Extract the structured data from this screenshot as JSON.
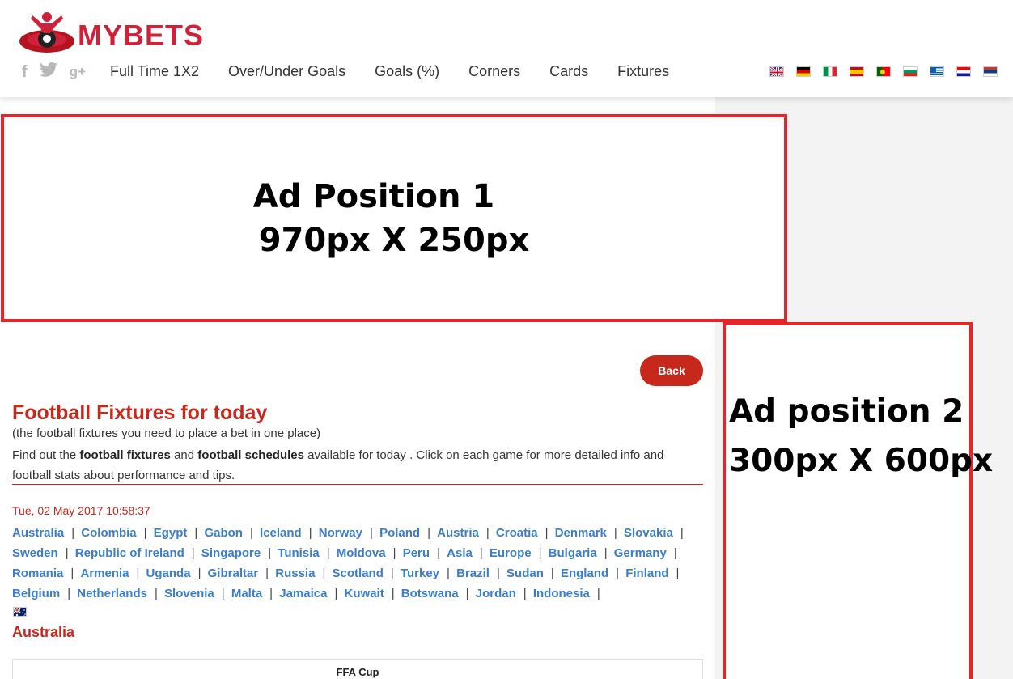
{
  "brand": {
    "name": "MYBETS",
    "color": "#d0213a"
  },
  "social": [
    {
      "name": "facebook-icon",
      "glyph": "f"
    },
    {
      "name": "twitter-icon",
      "glyph": "🐦"
    },
    {
      "name": "google-plus-icon",
      "glyph": "g+"
    }
  ],
  "nav": [
    "Full Time 1X2",
    "Over/Under Goals",
    "Goals (%)",
    "Corners",
    "Cards",
    "Fixtures"
  ],
  "languages": [
    "uk-flag",
    "de-flag",
    "it-flag",
    "es-flag",
    "pt-flag",
    "bg-flag",
    "gr-flag",
    "hr-flag",
    "rs-flag"
  ],
  "ads": {
    "ad1": {
      "line1": "Ad Position 1",
      "line2": "970px X 250px"
    },
    "ad2": {
      "line1": "Ad position 2",
      "line2": "300px X 600px"
    }
  },
  "main": {
    "back_label": "Back",
    "title": "Football Fixtures for today",
    "subtitle": "(the football fixtures you need to place a bet in one place)",
    "intro_parts": {
      "p1": "Find out the ",
      "b1": "football fixtures",
      "p2": " and ",
      "b2": "football schedules",
      "p3": " available for today . Click on each game for more detailed info and football stats about performance and tips."
    },
    "datetime": "Tue, 02 May 2017 10:58:37",
    "countries": [
      "Australia",
      "Colombia",
      "Egypt",
      "Gabon",
      "Iceland",
      "Norway",
      "Poland",
      "Austria",
      "Croatia",
      "Denmark",
      "Slovakia",
      "Sweden",
      "Republic of Ireland",
      "Singapore",
      "Tunisia",
      "Moldova",
      "Peru",
      "Asia",
      "Europe",
      "Bulgaria",
      "Germany",
      "Romania",
      "Armenia",
      "Uganda",
      "Gibraltar",
      "Russia",
      "Scotland",
      "Turkey",
      "Brazil",
      "Sudan",
      "England",
      "Finland",
      "Belgium",
      "Netherlands",
      "Slovenia",
      "Malta",
      "Jamaica",
      "Kuwait",
      "Botswana",
      "Jordan",
      "Indonesia"
    ],
    "country_heading": "Australia",
    "competition": "FFA Cup"
  },
  "colors": {
    "accent": "#c7281c",
    "link": "#3a7dc9",
    "ad_border": "#e3262d"
  }
}
